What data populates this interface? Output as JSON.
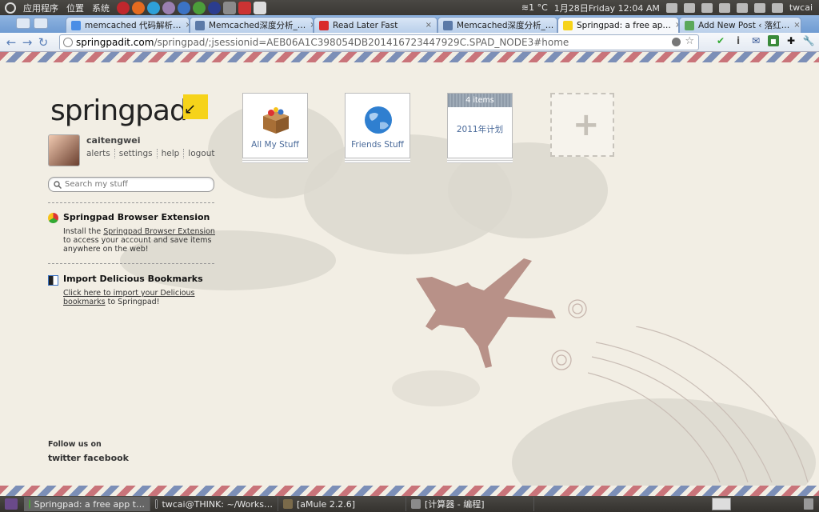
{
  "top_panel": {
    "menus": [
      "应用程序",
      "位置",
      "系统"
    ],
    "weather": "≋1 °C",
    "datetime": "1月28日Friday 12:04 AM",
    "user": "twcai"
  },
  "tabs": [
    {
      "title": "memcached 代码解析…",
      "icon_color": "#4a8ee6"
    },
    {
      "title": "Memcached深度分析_…",
      "icon_color": "#5b7aa8"
    },
    {
      "title": "Read Later Fast",
      "icon_color": "#d92b2b"
    },
    {
      "title": "Memcached深度分析_…",
      "icon_color": "#5b7aa8"
    },
    {
      "title": "Springpad: a free ap…",
      "icon_color": "#f6d31a"
    },
    {
      "title": "Add New Post ‹ 落红…",
      "icon_color": "#5aa85a"
    }
  ],
  "tab_close": "×",
  "toolbar": {
    "back": "←",
    "forward": "→",
    "reload": "↻",
    "url_host": "springpadit.com",
    "url_path": "/springpad/;jsessionid=AEB06A1C398054DB201416723447929C.SPAD_NODE3#home"
  },
  "brand": {
    "logo_text": "springpad"
  },
  "user": {
    "name": "caitengwei",
    "links": [
      "alerts",
      "settings",
      "help",
      "logout"
    ]
  },
  "search": {
    "placeholder": "Search my stuff"
  },
  "promo": {
    "extension_title": "Springpad Browser Extension",
    "extension_text_pre": "Install the ",
    "extension_link": "Springpad Browser Extension",
    "extension_text_post": " to access your account and save items anywhere on the web!",
    "delicious_title": "Import Delicious Bookmarks",
    "delicious_link": "Click here to import your Delicious bookmarks",
    "delicious_post": " to Springpad!"
  },
  "footer": {
    "follow": "Follow us on",
    "twitter": "twitter",
    "facebook": "facebook"
  },
  "notebooks": [
    {
      "label": "All My Stuff"
    },
    {
      "label": "Friends Stuff"
    },
    {
      "label": "2011年计划",
      "header": "4 items"
    }
  ],
  "add_notebook": "+",
  "taskbar": [
    {
      "label": "Springpad: a free app t…",
      "active": true
    },
    {
      "label": "twcai@THINK: ~/Works…",
      "active": false
    },
    {
      "label": "[aMule 2.2.6]",
      "active": false
    },
    {
      "label": "[计算器 - 编程]",
      "active": false
    }
  ]
}
